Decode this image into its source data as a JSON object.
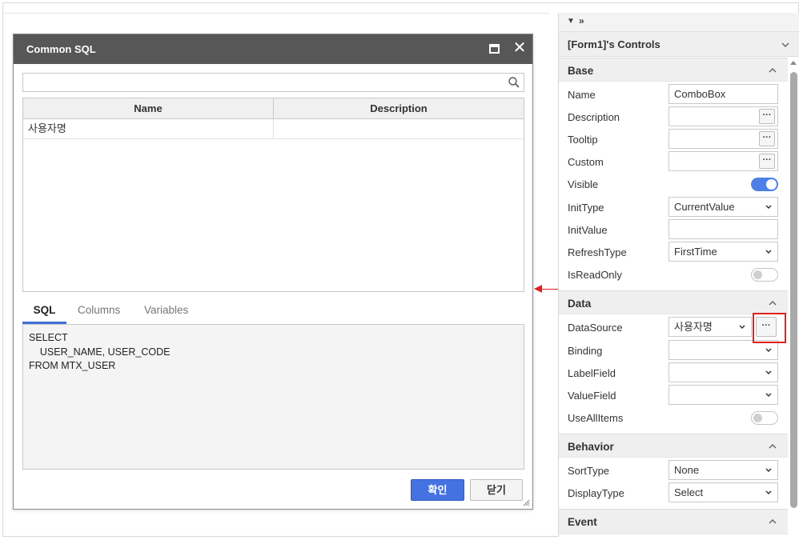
{
  "dialog": {
    "title": "Common SQL",
    "search": {
      "placeholder": ""
    },
    "grid": {
      "columns": [
        "Name",
        "Description"
      ],
      "rows": [
        {
          "name": "사용자명",
          "description": ""
        }
      ]
    },
    "tabs": [
      "SQL",
      "Columns",
      "Variables"
    ],
    "active_tab": "SQL",
    "sql_lines": [
      "SELECT",
      "    USER_NAME, USER_CODE",
      "FROM MTX_USER"
    ],
    "ok_label": "확인",
    "close_label": "닫기"
  },
  "panel": {
    "title": "[Form1]'s Controls",
    "sections": {
      "base": "Base",
      "data": "Data",
      "behavior": "Behavior",
      "event": "Event"
    },
    "props": {
      "name": {
        "label": "Name",
        "value": "ComboBox"
      },
      "description": {
        "label": "Description",
        "value": ""
      },
      "tooltip": {
        "label": "Tooltip",
        "value": ""
      },
      "custom": {
        "label": "Custom",
        "value": ""
      },
      "visible": {
        "label": "Visible",
        "value": true
      },
      "inittype": {
        "label": "InitType",
        "value": "CurrentValue"
      },
      "initvalue": {
        "label": "InitValue",
        "value": ""
      },
      "refreshtype": {
        "label": "RefreshType",
        "value": "FirstTime"
      },
      "isreadonly": {
        "label": "IsReadOnly",
        "value": false
      },
      "datasource": {
        "label": "DataSource",
        "value": "사용자명"
      },
      "binding": {
        "label": "Binding",
        "value": ""
      },
      "labelfield": {
        "label": "LabelField",
        "value": ""
      },
      "valuefield": {
        "label": "ValueField",
        "value": ""
      },
      "useallitems": {
        "label": "UseAllItems",
        "value": false
      },
      "sorttype": {
        "label": "SortType",
        "value": "None"
      },
      "displaytype": {
        "label": "DisplayType",
        "value": "Select"
      }
    },
    "dots_label": "···"
  },
  "colors": {
    "accent": "#4472e0",
    "highlight": "#e02020",
    "titlebar": "#575757"
  }
}
